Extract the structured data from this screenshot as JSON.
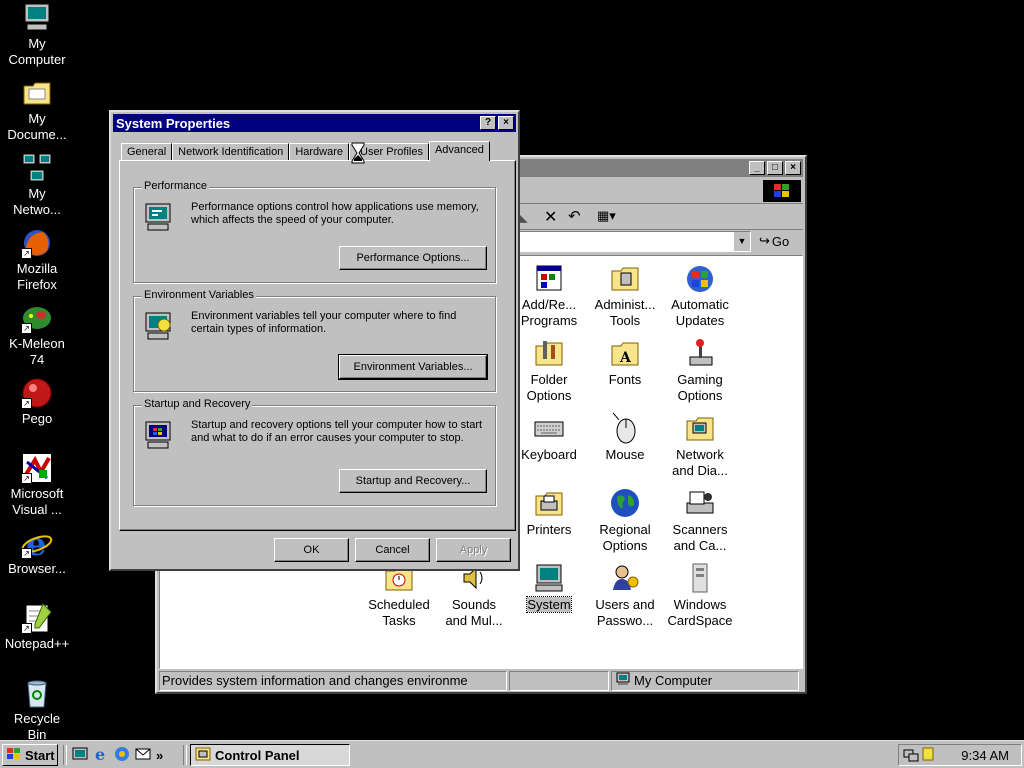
{
  "desktop": {
    "icons": [
      {
        "label": "My\nComputer",
        "icon": "my-computer-icon"
      },
      {
        "label": "My\nDocume...",
        "icon": "folder-icon"
      },
      {
        "label": "My\nNetwo...",
        "icon": "network-icon"
      },
      {
        "label": "Mozilla\nFirefox",
        "icon": "firefox-icon"
      },
      {
        "label": "K-Meleon\n74",
        "icon": "k-meleon-icon"
      },
      {
        "label": "Pego",
        "icon": "pego-icon"
      },
      {
        "label": "Microsoft\nVisual ...",
        "icon": "visual-studio-icon"
      },
      {
        "label": "Browser...",
        "icon": "internet-explorer-icon"
      },
      {
        "label": "Notepad++",
        "icon": "notepad-icon"
      },
      {
        "label": "Recycle\nBin",
        "icon": "recycle-bin-icon"
      }
    ]
  },
  "control_panel": {
    "title_buttons": {
      "min": "_",
      "max": "□",
      "close": "×"
    },
    "address_go": "Go",
    "icons": [
      {
        "label": "Add/Re...\nPrograms",
        "icon": "add-remove-programs-icon"
      },
      {
        "label": "Administ...\nTools",
        "icon": "admin-tools-icon"
      },
      {
        "label": "Automatic\nUpdates",
        "icon": "automatic-updates-icon"
      },
      {
        "label": "Folder\nOptions",
        "icon": "folder-options-icon"
      },
      {
        "label": "Fonts",
        "icon": "fonts-icon"
      },
      {
        "label": "Gaming\nOptions",
        "icon": "gaming-options-icon"
      },
      {
        "label": "Keyboard",
        "icon": "keyboard-icon"
      },
      {
        "label": "Mouse",
        "icon": "mouse-icon"
      },
      {
        "label": "Network\nand Dia...",
        "icon": "network-dialup-icon"
      },
      {
        "label": "Printers",
        "icon": "printers-icon"
      },
      {
        "label": "Regional\nOptions",
        "icon": "regional-options-icon"
      },
      {
        "label": "Scanners\nand Ca...",
        "icon": "scanners-icon"
      },
      {
        "label": "Scheduled\nTasks",
        "icon": "scheduled-tasks-icon"
      },
      {
        "label": "Sounds\nand Mul...",
        "icon": "sounds-icon"
      },
      {
        "label": "System",
        "icon": "system-icon"
      },
      {
        "label": "Users and\nPasswo...",
        "icon": "users-icon"
      },
      {
        "label": "Windows\nCardSpace",
        "icon": "cardspace-icon"
      }
    ],
    "status_text": "Provides system information and changes environme",
    "status_location": "My Computer"
  },
  "dialog": {
    "title": "System Properties",
    "help_btn": "?",
    "close_btn": "×",
    "tabs": [
      "General",
      "Network Identification",
      "Hardware",
      "User Profiles",
      "Advanced"
    ],
    "active_tab": "Advanced",
    "groups": {
      "performance": {
        "title": "Performance",
        "text": "Performance options control how applications use memory, which affects the speed of your computer.",
        "button": "Performance Options..."
      },
      "environment": {
        "title": "Environment Variables",
        "text": "Environment variables tell your computer where to find certain types of information.",
        "button": "Environment Variables..."
      },
      "startup": {
        "title": "Startup and Recovery",
        "text": "Startup and recovery options tell your computer how to start and what to do if an error causes your computer to stop.",
        "button": "Startup and Recovery..."
      }
    },
    "ok": "OK",
    "cancel": "Cancel",
    "apply": "Apply"
  },
  "taskbar": {
    "start": "Start",
    "task": "Control Panel",
    "clock": "9:34 AM",
    "quicklaunch_more": "»"
  }
}
